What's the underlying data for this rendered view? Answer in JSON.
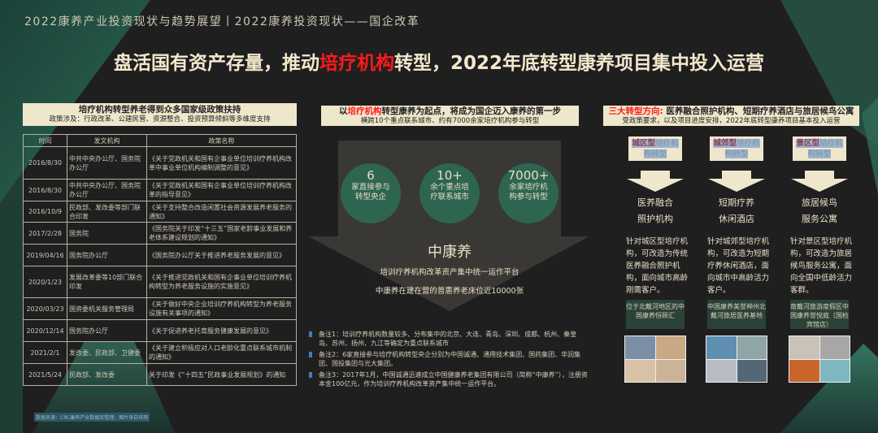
{
  "header": {
    "supertitle": "2022康养产业投资现状与趋势展望丨2022康养投资现状——国企改革",
    "title_pre": "盘活国有资产存量，推动",
    "title_red": "培疗机构",
    "title_post": "转型，2022年底转型康养项目集中投入运营"
  },
  "left": {
    "banner_title": "培疗机构转型养老得到众多国家级政策扶持",
    "banner_sub": "政策涉及：行政改革、公建民营、资源整合、投资预算倾斜等多维度支持",
    "columns": [
      "时间",
      "发文机构",
      "政策名称"
    ],
    "rows": [
      [
        "2016/8/30",
        "中共中央办公厅、国务院办公厅",
        "《关于党政机关和国有企事业单位培训疗养机构改革中事业单位机构编制调整的意见》"
      ],
      [
        "2016/8/30",
        "中共中央办公厅、国务院办公厅",
        "《关于党政机关和国有企事业单位培训疗养机构改革的指导意见》"
      ],
      [
        "2016/10/9",
        "民政部、发改委等部门联合印发",
        "《关于支持整合改造闲置社会资源发展养老服务的通知》"
      ],
      [
        "2017/2/28",
        "国务院",
        "《国务院关于印发“十三五”国家老龄事业发展和养老体系建设规划的通知》"
      ],
      [
        "2019/04/16",
        "国务院办公厅",
        "《国务院办公厅关于推进养老服务发展的意见》"
      ],
      [
        "2020/1/23",
        "发展改革委等10部门联合印发",
        "《关于推进党政机关和国有企事业单位培训疗养机构转型为养老服务设施的实施意见》"
      ],
      [
        "2020/03/23",
        "国资委机关服务管理局",
        "《关于做好中央企业培训疗养机构转型为养老服务设施有关事项的通知》"
      ],
      [
        "2020/12/14",
        "国务院办公厅",
        "《关于促进养老托育服务健康发展的意见》"
      ],
      [
        "2021/2/1",
        "发改委、民政部、卫健委",
        "《关于建立积极应对人口老龄化重点联系城市机制的通知》"
      ],
      [
        "2021/5/24",
        "民政部、发改委",
        "关于印发《“十四五”民政事业发展规划》的通知"
      ]
    ],
    "source": "数据来源：CRC康养产业数据库整理，图片来自官网"
  },
  "middle": {
    "banner_pre": "以",
    "banner_red": "培疗机构",
    "banner_post": "转型康养为起点，将成为国企迈入康养的第一步",
    "banner_sub": "横跨10个重点联系城市、约有7000余家培疗机构参与转型",
    "stats": [
      {
        "value": "6",
        "label": "家直接参与转型央企"
      },
      {
        "value": "10+",
        "label": "余个重点培疗联系城市"
      },
      {
        "value": "7000+",
        "label": "余家培疗机构参与转型"
      }
    ],
    "company": "中康养",
    "line1": "培训疗养机构改革资产集中统一运作平台",
    "line2": "中康养在建在营的普惠养老床位近10000张",
    "notes": [
      "备注1：培训疗养机构数量较多、分布集中的北京、大连、青岛、深圳、成都、杭州、秦皇岛、苏州、扬州、九江等确定为重点联系城市",
      "备注2：6家直接参与培疗机构转型央企分别为中国诚通、通用技术集团、国药集团、华润集团、国投集团与光大集团。",
      "备注3：2017年1月，中国诚通迅速成立中国健康养老集团有限公司（简称“中康养”），注册资本金100亿元，作为培训疗养机构改革资产集中统一运作平台。"
    ]
  },
  "right": {
    "banner_red": "三大转型方向:",
    "banner_title": " 医养融合照护机构、短期疗养酒店与旅居候鸟公寓",
    "banner_sub": "受政策要求，以及项目进度安排，2022年底转型康养项目基本投入运营",
    "columns": [
      {
        "tag_bold": "城区型",
        "tag_rest": "培疗机构转型",
        "title1": "医养融合",
        "title2": "照护机构",
        "desc": "针对城区型培疗机构，可改造为传统医养融合照护机构，面向城市高龄刚需客户。",
        "caption": "位于北戴河地区的中国康养恒颐汇"
      },
      {
        "tag_bold": "城郊型",
        "tag_rest": "培疗机构转型",
        "title1": "短期疗养",
        "title2": "休闲酒店",
        "desc": "针对城郊型培疗机构，可改造为短期疗养休闲酒店，面向城市中高龄活力客户。",
        "caption": "中国康养美誉神州北戴河旅居医养基地"
      },
      {
        "tag_bold": "景区型",
        "tag_rest": "培疗机构转型",
        "title1": "旅居候鸟",
        "title2": "服务公寓",
        "desc": "针对景区型培疗机构，可改造为旅居候鸟服务公寓，面向全国中低龄活力客群。",
        "caption": "南戴河旅游度假区中国康养誉悦庭（国检宾馆店）"
      }
    ]
  },
  "colors": {
    "accent_red": "#ff1a1a",
    "green": "#2d6551",
    "cream": "#efe7cc",
    "bg": "#1f1f20"
  }
}
